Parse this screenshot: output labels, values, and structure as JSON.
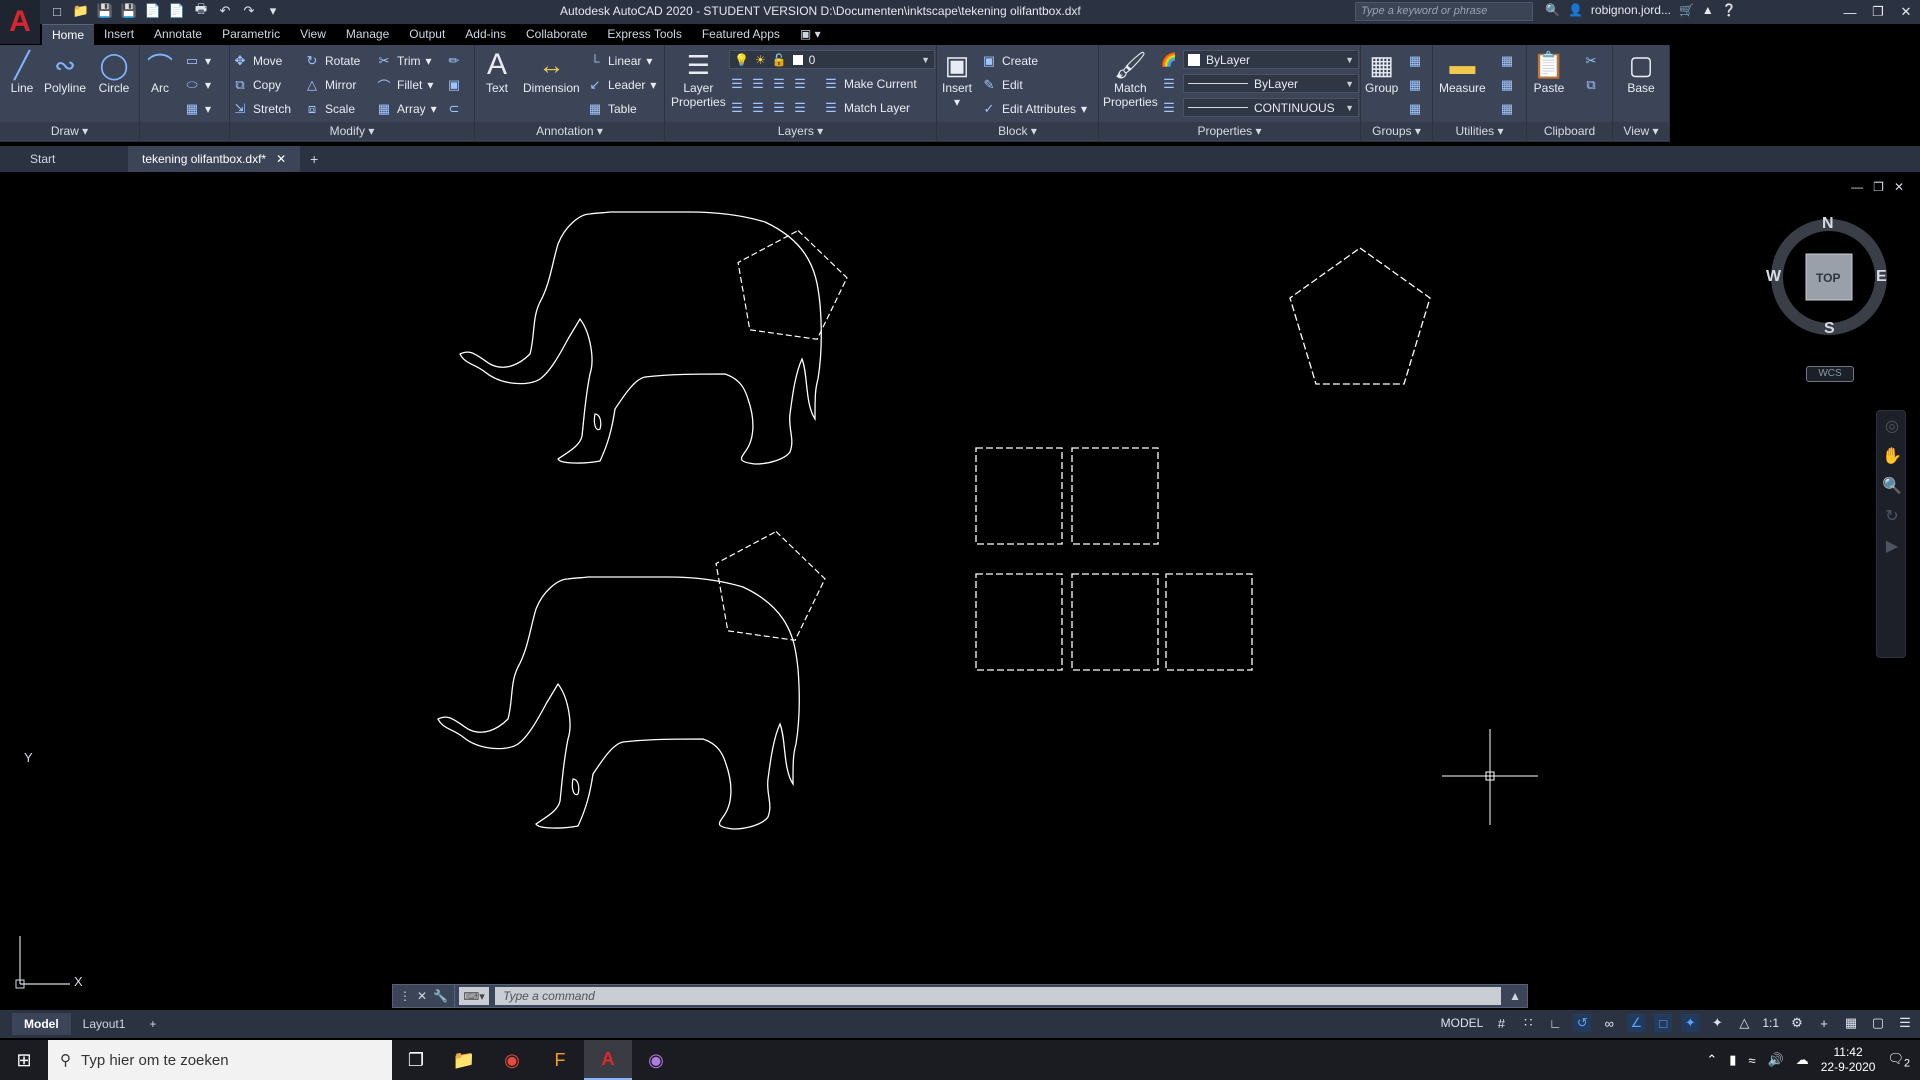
{
  "titlebar": {
    "title": "Autodesk AutoCAD 2020 - STUDENT VERSION    D:\\Documenten\\inktscape\\tekening olifantbox.dxf",
    "search_placeholder": "Type a keyword or phrase",
    "user": "robignon.jord..."
  },
  "ribbon_tabs": [
    "Home",
    "Insert",
    "Annotate",
    "Parametric",
    "View",
    "Manage",
    "Output",
    "Add-ins",
    "Collaborate",
    "Express Tools",
    "Featured Apps"
  ],
  "draw": {
    "title": "Draw",
    "line": "Line",
    "polyline": "Polyline",
    "circle": "Circle",
    "arc": "Arc"
  },
  "modify": {
    "title": "Modify",
    "move": "Move",
    "rotate": "Rotate",
    "trim": "Trim",
    "copy": "Copy",
    "mirror": "Mirror",
    "fillet": "Fillet",
    "stretch": "Stretch",
    "scale": "Scale",
    "array": "Array"
  },
  "annotation": {
    "title": "Annotation",
    "text": "Text",
    "dimension": "Dimension",
    "linear": "Linear",
    "leader": "Leader",
    "table": "Table"
  },
  "layers": {
    "title": "Layers",
    "layer_properties_1": "Layer",
    "layer_properties_2": "Properties",
    "current_layer": "0",
    "make_current": "Make Current",
    "match_layer": "Match Layer"
  },
  "block": {
    "title": "Block",
    "insert": "Insert",
    "create": "Create",
    "edit": "Edit",
    "edit_attributes": "Edit Attributes"
  },
  "properties": {
    "title": "Properties",
    "match_1": "Match",
    "match_2": "Properties",
    "color": "ByLayer",
    "lineweight": "ByLayer",
    "linetype": "CONTINUOUS"
  },
  "groups": {
    "title": "Groups",
    "group": "Group"
  },
  "utilities": {
    "title": "Utilities",
    "measure": "Measure"
  },
  "clipboard": {
    "title": "Clipboard",
    "paste": "Paste"
  },
  "view_panel": {
    "title": "View",
    "base": "Base"
  },
  "doc_tabs": {
    "start": "Start",
    "file": "tekening olifantbox.dxf*"
  },
  "viewcube": {
    "n": "N",
    "s": "S",
    "e": "E",
    "w": "W",
    "face": "TOP",
    "wcs": "WCS"
  },
  "ucs": {
    "x": "X",
    "y": "Y"
  },
  "command": {
    "placeholder": "Type a command"
  },
  "layout_tabs": [
    "Model",
    "Layout1"
  ],
  "status": {
    "model": "MODEL",
    "scale": "1:1"
  },
  "taskbar": {
    "search": "Typ hier om te zoeken",
    "time": "11:42",
    "date": "22-9-2020",
    "notifications": "2"
  }
}
